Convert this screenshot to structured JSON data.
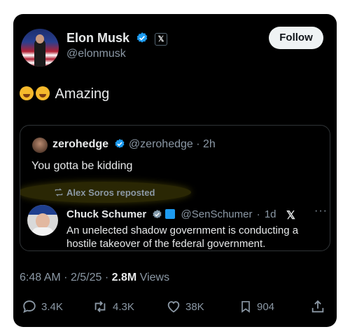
{
  "author": {
    "name": "Elon Musk",
    "handle": "@elonmusk",
    "x_badge": "𝕏"
  },
  "follow_label": "Follow",
  "tweet": {
    "text": "Amazing",
    "emoji": [
      "rolling-on-floor-laughing",
      "rolling-on-floor-laughing"
    ]
  },
  "quote": {
    "name": "zerohedge",
    "handle": "@zerohedge",
    "dot": "·",
    "time": "2h",
    "text": "You gotta be kidding",
    "repost_label": "Alex Soros reposted",
    "inner": {
      "name": "Chuck Schumer",
      "handle": "@SenSchumer",
      "dot": "·",
      "time": "1d",
      "text": "An unelected shadow government is conducting a hostile takeover of the federal government.",
      "x_mark": "𝕏",
      "more": "···"
    }
  },
  "meta": {
    "time": "6:48 AM",
    "sep1": "·",
    "date": "2/5/25",
    "sep2": "·",
    "views_count": "2.8M",
    "views_label": "Views"
  },
  "actions": {
    "replies": "3.4K",
    "reposts": "4.3K",
    "likes": "38K",
    "bookmarks": "904"
  },
  "colors": {
    "verified": "#1d9bf0",
    "muted": "#8b98a5",
    "highlight": "#e8d614"
  }
}
